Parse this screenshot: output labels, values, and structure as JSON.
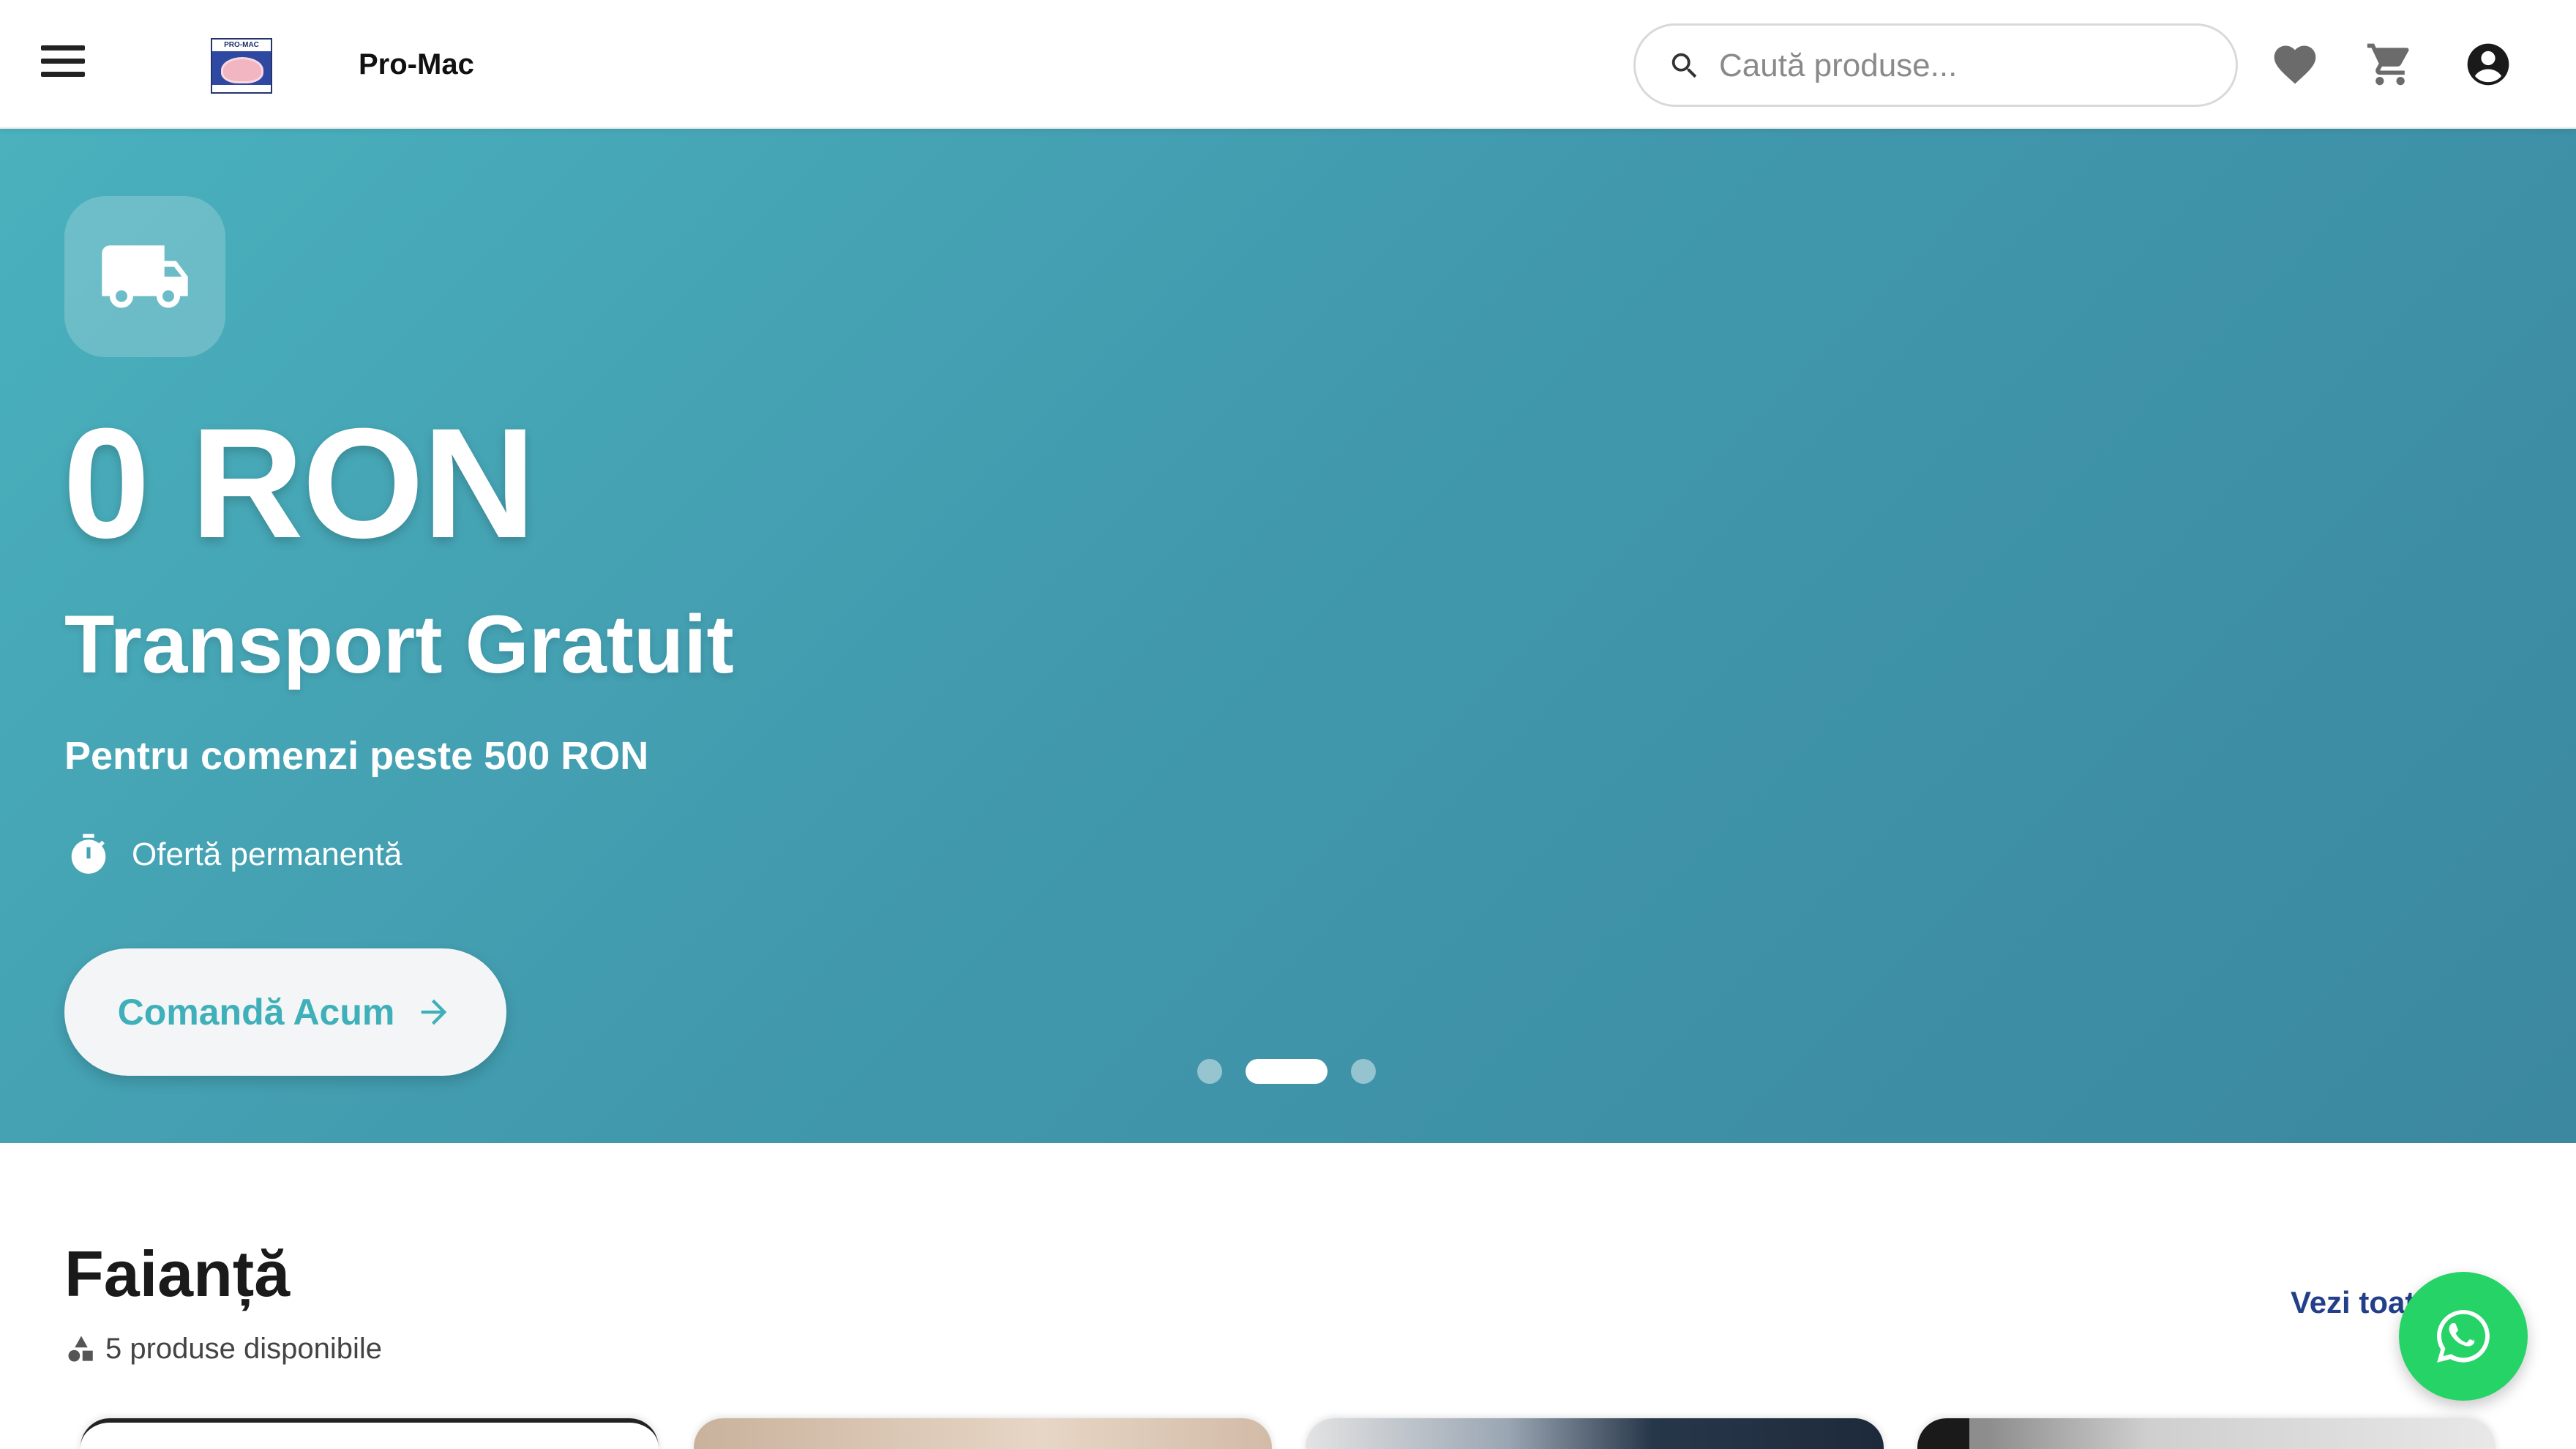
{
  "header": {
    "brand_name": "Pro-Mac",
    "logo_text": "PRO-MAC",
    "search": {
      "placeholder": "Caută produse...",
      "value": ""
    },
    "icons": [
      "menu-icon",
      "heart-icon",
      "cart-icon",
      "account-icon",
      "search-icon"
    ]
  },
  "hero": {
    "icon": "truck-icon",
    "price": "0 RON",
    "title": "Transport Gratuit",
    "subtitle": "Pentru comenzi peste 500 RON",
    "tag_icon": "timer-icon",
    "tag_text": "Ofertă permanentă",
    "cta_label": "Comandă Acum",
    "cta_icon": "arrow-right-icon",
    "slides_total": 3,
    "active_slide": 2,
    "gradient_colors": [
      "#4ab1bd",
      "#3b88a0"
    ]
  },
  "section": {
    "title": "Faianță",
    "count_icon": "shapes-icon",
    "count_text": "5 produse disponibile",
    "see_all": "Vezi toate"
  },
  "floating": {
    "icon": "whatsapp-icon",
    "color": "#25d366"
  },
  "colors": {
    "accent": "#3fb0b9",
    "link": "#233f8a"
  }
}
